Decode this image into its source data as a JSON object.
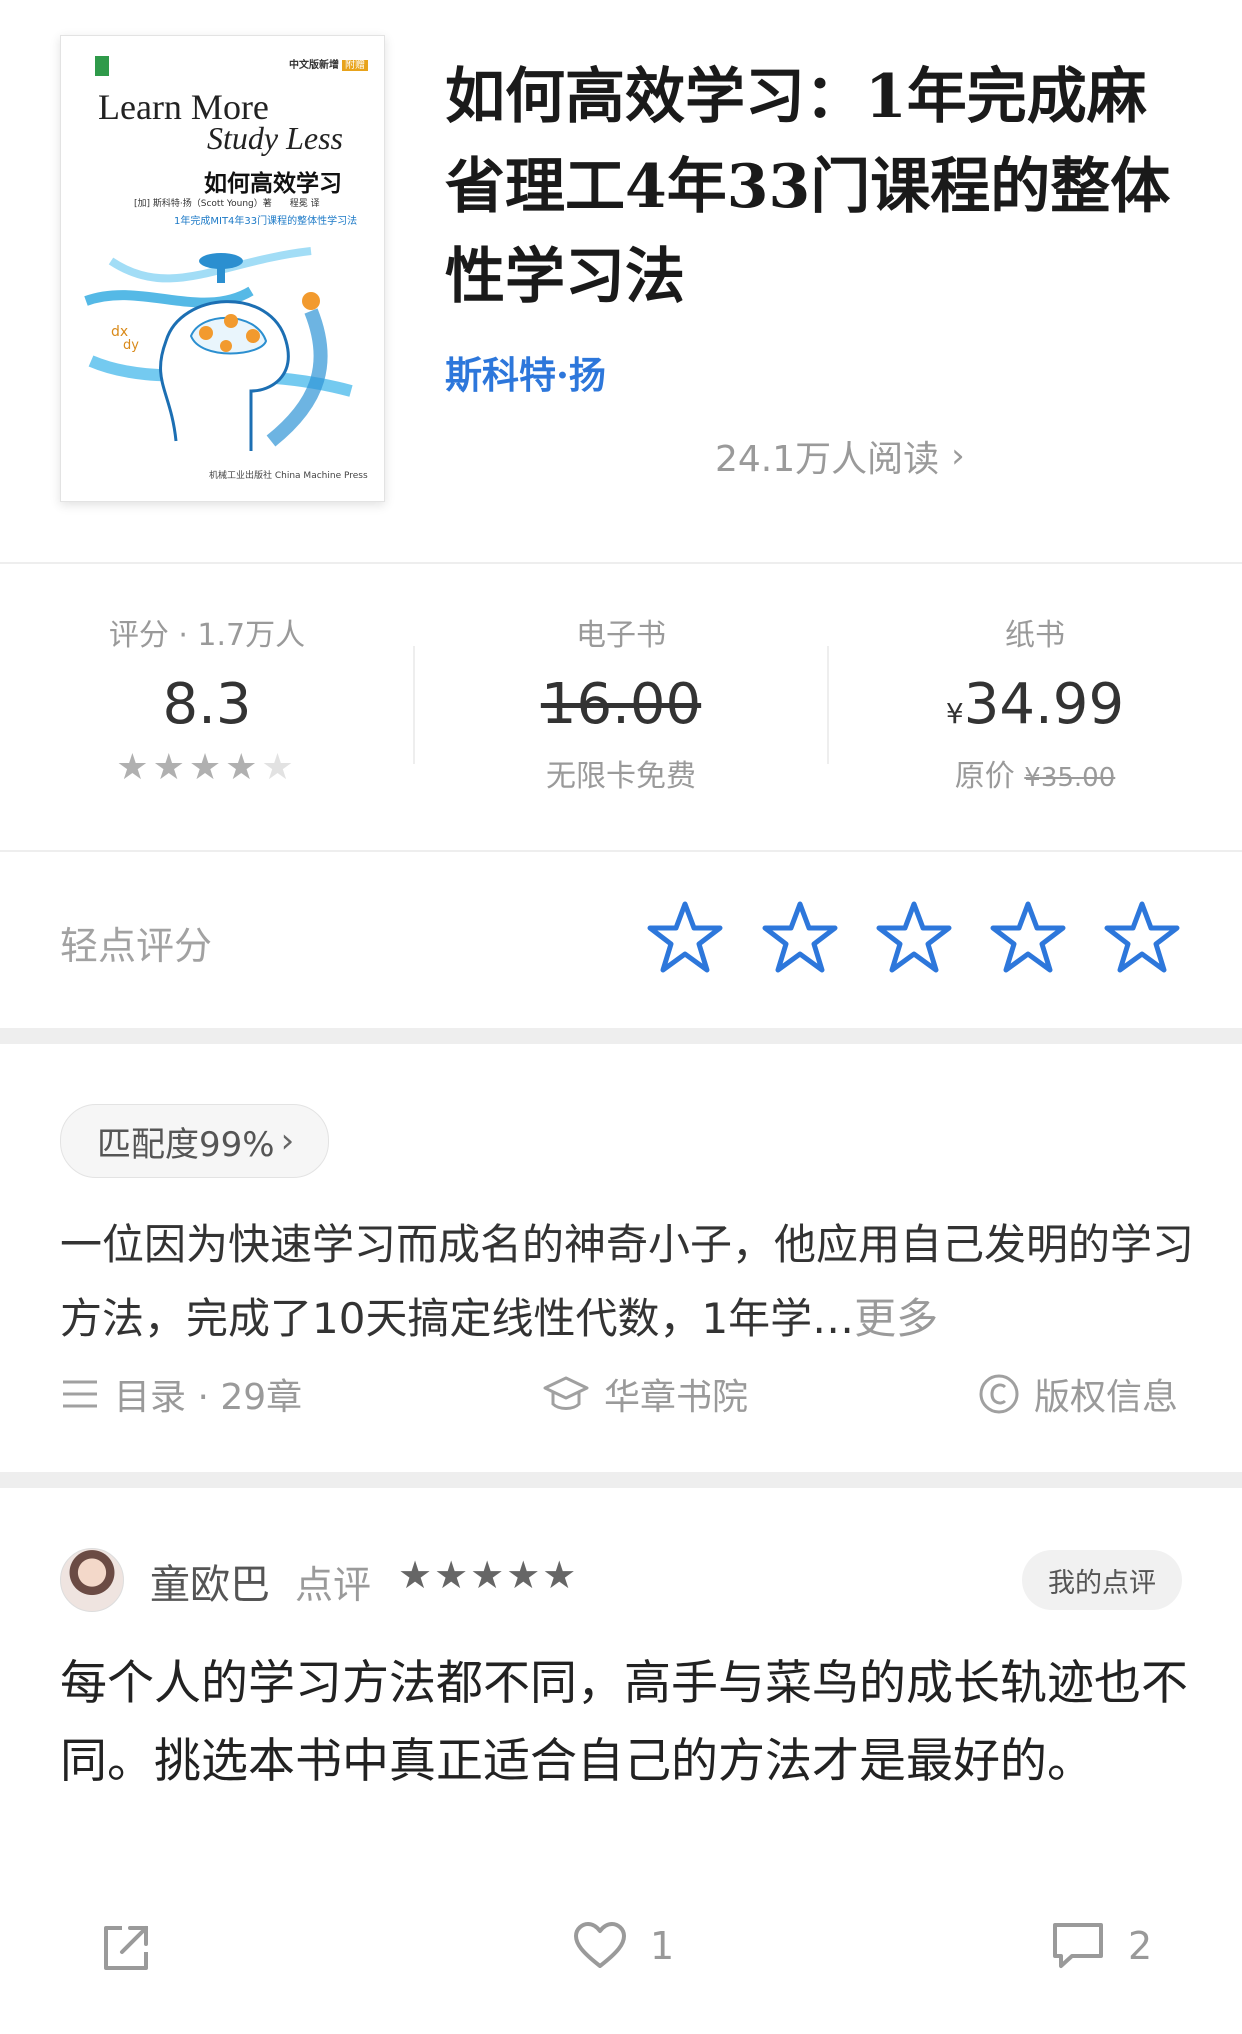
{
  "book": {
    "title": "如何高效学习：1年完成麻省理工4年33门课程的整体性学习法",
    "author": "斯科特·扬",
    "readers": "24.1万人阅读",
    "cover": {
      "corner_label": "中文版新增",
      "corner_badge": "附赠",
      "title_en_1": "Learn More",
      "title_en_2": "Study Less",
      "title_cn": "如何高效学习",
      "author_line": "[加] 斯科特·扬（Scott Young）著　　程冕 译",
      "tagline": "1年完成MIT4年33门课程的整体性学习法",
      "publisher": "机械工业出版社 China Machine Press"
    }
  },
  "stats": {
    "rating": {
      "label": "评分 · 1.7万人",
      "value": "8.3",
      "stars_filled": 4,
      "stars_total": 5
    },
    "ebook": {
      "label": "电子书",
      "price": "16.00",
      "note": "无限卡免费"
    },
    "paper": {
      "label": "纸书",
      "currency": "¥",
      "price": "34.99",
      "orig_label": "原价",
      "orig_price": "¥35.00"
    }
  },
  "tap_rating": {
    "label": "轻点评分",
    "stars": 5,
    "star_color": "#2d77db"
  },
  "intro": {
    "match": "匹配度99%",
    "text": "一位因为快速学习而成名的神奇小子，他应用自己发明的学习方法，完成了10天搞定线性代数，1年学…",
    "more": "更多",
    "toc": "目录 · 29章",
    "publisher": "华章书院",
    "copyright": "版权信息"
  },
  "review": {
    "user": "童欧巴",
    "type": "点评",
    "stars": "★★★★★",
    "my_review": "我的点评",
    "text": "每个人的学习方法都不同，高手与菜鸟的成长轨迹也不同。挑选本书中真正适合自己的方法才是最好的。",
    "likes": "1",
    "comments": "2"
  },
  "icons": [
    "chevron-right-icon",
    "star-outline-icon",
    "menu-icon",
    "graduation-cap-icon",
    "copyright-icon",
    "share-icon",
    "heart-icon",
    "comment-icon"
  ]
}
